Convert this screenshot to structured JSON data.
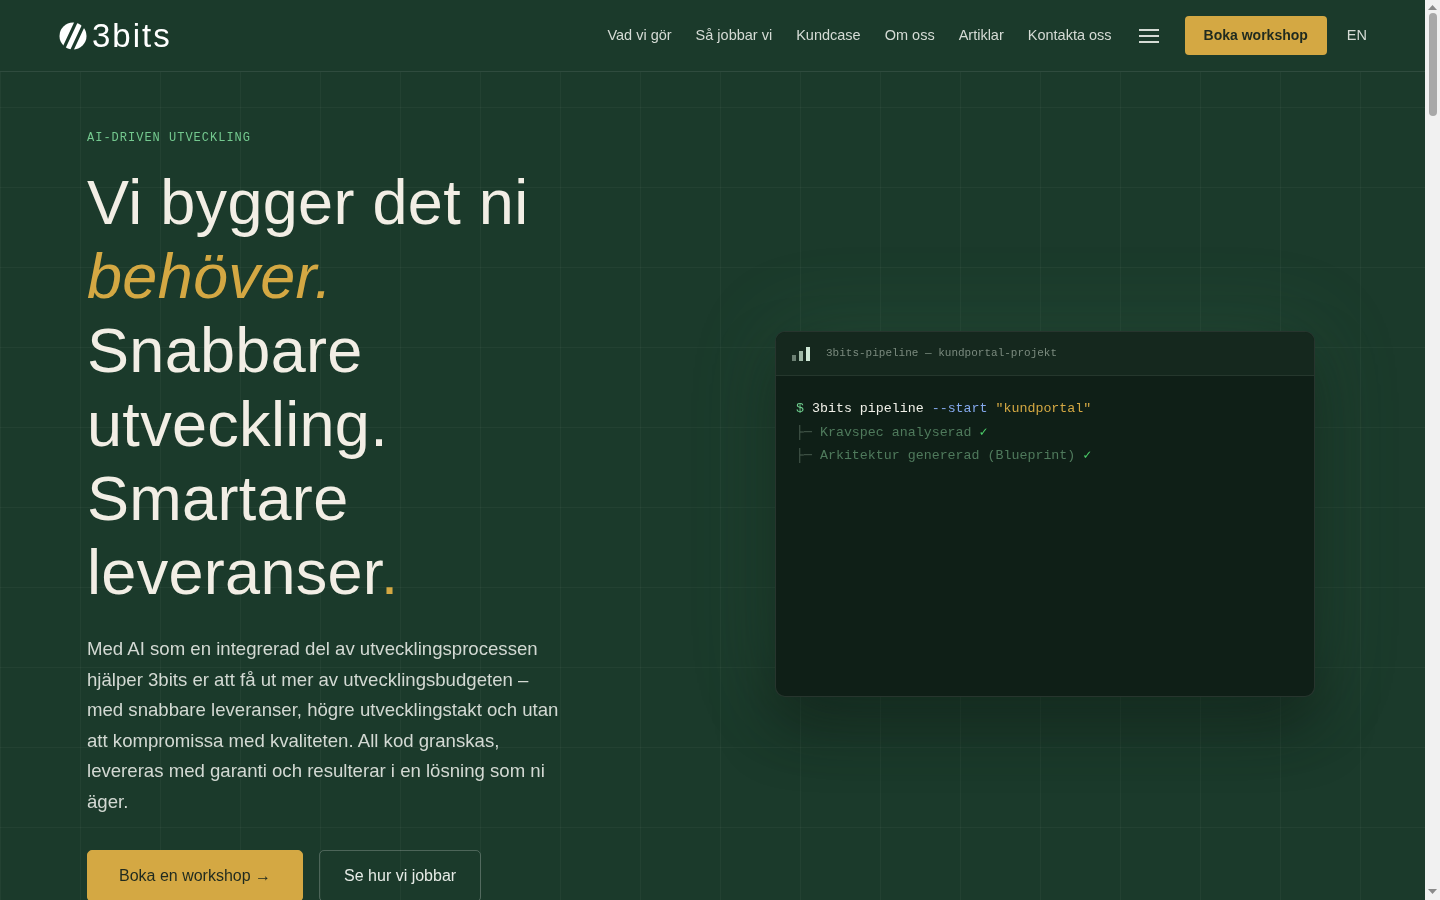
{
  "header": {
    "logo": {
      "text": "3bits"
    },
    "nav_links": [
      "Vad vi gör",
      "Så jobbar vi",
      "Kundcase",
      "Om oss",
      "Artiklar",
      "Kontakta oss"
    ],
    "cta": "Boka workshop",
    "language": "EN"
  },
  "hero": {
    "eyebrow": "AI-DRIVEN UTVECKLING",
    "headline": [
      [
        {
          "text": "Vi bygger det ni",
          "kind": "plain"
        }
      ],
      [
        {
          "text": "behöver.",
          "kind": "highlight"
        }
      ],
      [
        {
          "text": "Snabbare",
          "kind": "plain"
        }
      ],
      [
        {
          "text": "utveckling.",
          "kind": "plain"
        }
      ],
      [
        {
          "text": "Smartare",
          "kind": "plain"
        }
      ],
      [
        {
          "text": "leveranser",
          "kind": "plain"
        },
        {
          "text": ".",
          "kind": "accent"
        }
      ]
    ],
    "description": "Med AI som en integrerad del av utvecklingsprocessen hjälper 3bits er att få ut mer av utvecklingsbudgeten – med snabbare leveranser, högre utvecklingstakt och utan att kompromissa med kvaliteten. All kod granskas, levereras med garanti och resulterar i en lösning som ni äger.",
    "buttons": [
      {
        "label": "Boka en workshop →",
        "kind": "primary"
      },
      {
        "label": "Se hur vi jobbar",
        "kind": "outline"
      }
    ]
  },
  "terminal": {
    "title": "3bits-pipeline — kundportal-projekt",
    "lines": [
      {
        "tokens": [
          {
            "text": "$",
            "kind": "prompt"
          },
          {
            "text": "3bits pipeline",
            "kind": "command"
          },
          {
            "text": "--start",
            "kind": "flag"
          },
          {
            "text": "\"kundportal\"",
            "kind": "string"
          }
        ]
      },
      {
        "tokens": [
          {
            "text": "├─",
            "kind": "tree"
          },
          {
            "text": "Kravspec analyserad",
            "kind": "output"
          },
          {
            "text": "✓",
            "kind": "check"
          }
        ]
      },
      {
        "tokens": [
          {
            "text": "├─",
            "kind": "tree"
          },
          {
            "text": "Arkitektur genererad (Blueprint)",
            "kind": "output"
          },
          {
            "text": "✓",
            "kind": "check"
          }
        ]
      }
    ]
  }
}
